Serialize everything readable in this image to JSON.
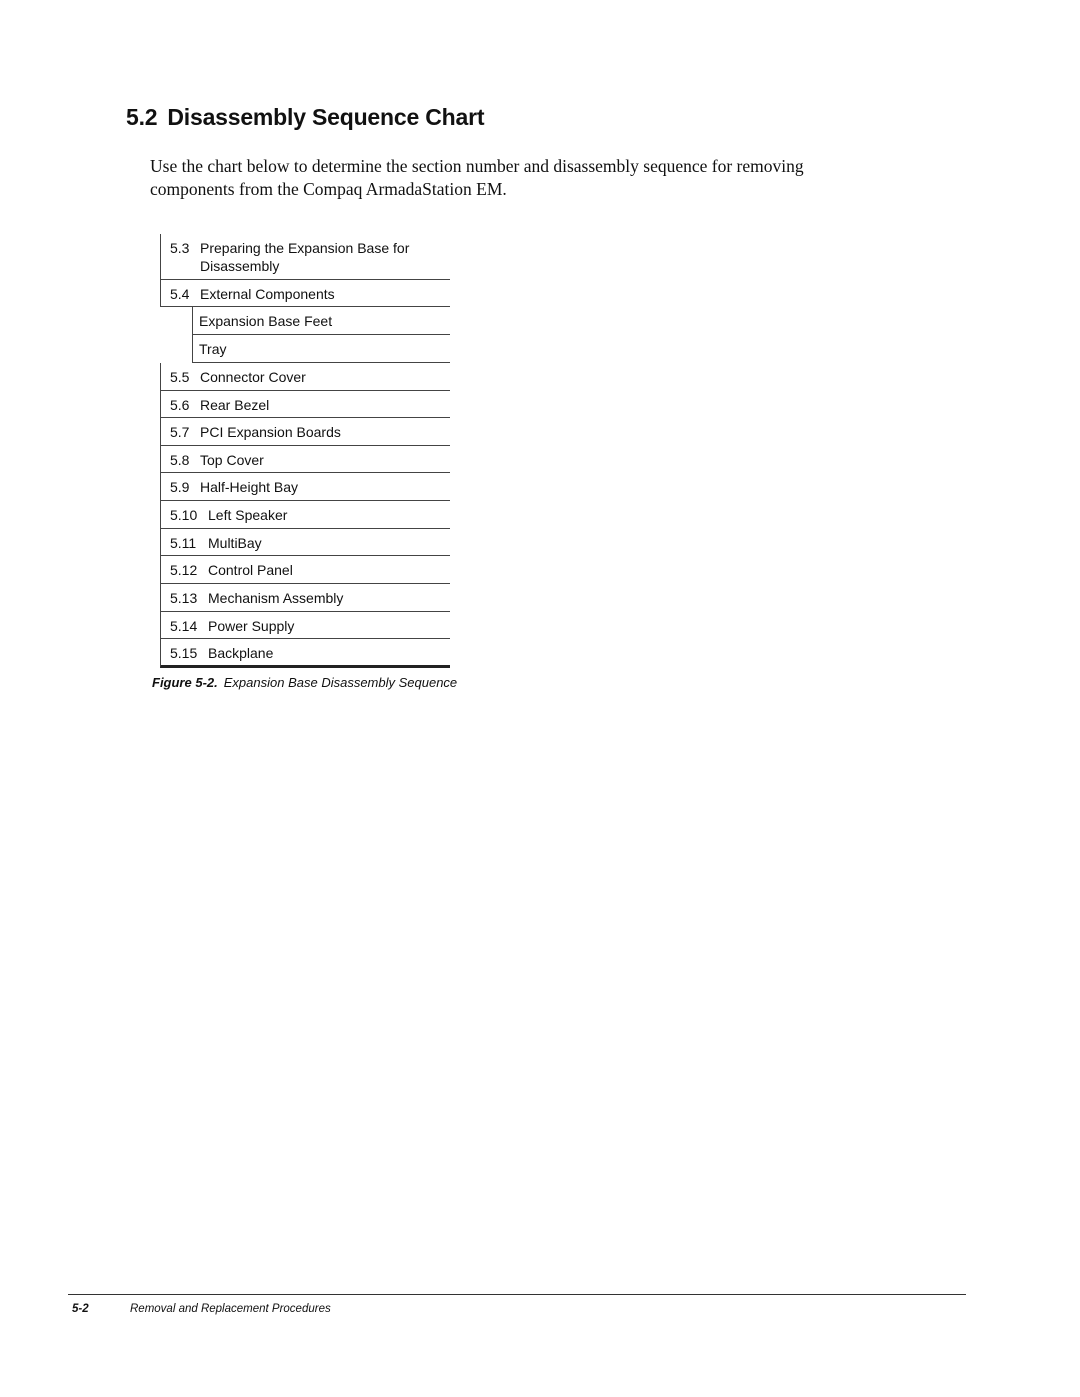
{
  "heading": {
    "number": "5.2",
    "title": "Disassembly Sequence Chart"
  },
  "intro": "Use the chart below to determine the section number and disassembly sequence for removing components from the Compaq ArmadaStation EM.",
  "sequence": [
    {
      "section": "5.3",
      "label": "Preparing the Expansion Base for",
      "label2": "Disassembly",
      "level": 0
    },
    {
      "section": "5.4",
      "label": "External Components",
      "level": 0
    },
    {
      "section": "",
      "label": "Expansion Base Feet",
      "level": 1
    },
    {
      "section": "",
      "label": "Tray",
      "level": 1
    },
    {
      "section": "5.5",
      "label": "Connector Cover",
      "level": 0
    },
    {
      "section": "5.6",
      "label": "Rear Bezel",
      "level": 0
    },
    {
      "section": "5.7",
      "label": "PCI Expansion Boards",
      "level": 0
    },
    {
      "section": "5.8",
      "label": "Top Cover",
      "level": 0
    },
    {
      "section": "5.9",
      "label": "Half-Height Bay",
      "level": 0
    },
    {
      "section": "5.10",
      "label": "Left Speaker",
      "level": 0
    },
    {
      "section": "5.11",
      "label": "MultiBay",
      "level": 0
    },
    {
      "section": "5.12",
      "label": "Control Panel",
      "level": 0
    },
    {
      "section": "5.13",
      "label": "Mechanism Assembly",
      "level": 0
    },
    {
      "section": "5.14",
      "label": "Power Supply",
      "level": 0
    },
    {
      "section": "5.15",
      "label": "Backplane",
      "level": 0
    }
  ],
  "caption": {
    "label": "Figure 5-2.",
    "text": "Expansion Base Disassembly Sequence"
  },
  "footer": {
    "page": "5-2",
    "title": "Removal and Replacement Procedures"
  }
}
